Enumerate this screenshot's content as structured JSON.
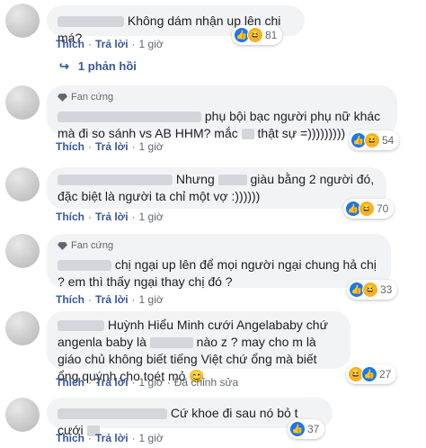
{
  "labels": {
    "like": "Thích",
    "reply": "Trả lời",
    "edited": "Đã chỉnh sửa",
    "top_fan": "Fan cứng"
  },
  "comments": [
    {
      "text": " Không dám nhận up lên chi má?",
      "time": "1 giờ",
      "reactions": "81"
    },
    {
      "text": "phụ bội bạc người phụ nữ khác mà đi so sánh vs AB HHM? mắc ",
      "text2": " thật sự =)))))))))",
      "time": "1 giờ",
      "reactions": "54"
    },
    {
      "text": " Nhưng ",
      "text2": " giàu bằng 2 người đó, đặc biệt là người ta chỉ một vợ :))))))",
      "time": "1 giờ",
      "reactions": "70"
    },
    {
      "text": " chị ngại up lên để mọi người ngại chung hả chị ? em thì thấy ngại thay chị đó ?",
      "time": "1 giờ",
      "reactions": "33"
    },
    {
      "text": " Huỳnh Hiểu Minh cưới Angelababy chứ angenla baby là ",
      "text2": " nào z ? may cho m là giáo chủ không biết tiếng Việt chứ ổng mà biết ổng quýnh cho toét mỏ ",
      "time": "1 giờ",
      "reactions": "27"
    },
    {
      "text": " Cứ khoe đi sau nó bỏ t cưới ",
      "time": "1 giờ",
      "reactions": "37"
    }
  ],
  "replies": {
    "label": "1 phản hồi"
  },
  "icons": {
    "like": "like-icon",
    "haha": "haha-icon",
    "reply_arrow": "reply-arrow-icon",
    "fan": "diamond-icon"
  }
}
